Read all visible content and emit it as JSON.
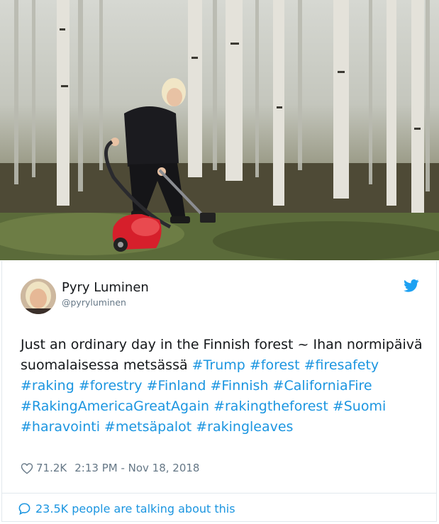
{
  "photo": {
    "subject": "tweet-photo"
  },
  "author": {
    "name": "Pyry Luminen",
    "handle": "@pyryluminen"
  },
  "icons": {
    "platform": "bird-icon",
    "like": "heart-icon",
    "reply": "speech-bubble-icon"
  },
  "tweet": {
    "text_segments": [
      {
        "text": "Just an ordinary day in the Finnish forest ~ Ihan normipäivä suomalaisessa metsässä ",
        "tag": false
      },
      {
        "text": "#Trump",
        "tag": true
      },
      {
        "text": " ",
        "tag": false
      },
      {
        "text": "#forest",
        "tag": true
      },
      {
        "text": " ",
        "tag": false
      },
      {
        "text": "#firesafety",
        "tag": true
      },
      {
        "text": " ",
        "tag": false
      },
      {
        "text": "#raking",
        "tag": true
      },
      {
        "text": " ",
        "tag": false
      },
      {
        "text": "#forestry",
        "tag": true
      },
      {
        "text": " ",
        "tag": false
      },
      {
        "text": "#Finland",
        "tag": true
      },
      {
        "text": " ",
        "tag": false
      },
      {
        "text": "#Finnish",
        "tag": true
      },
      {
        "text": " ",
        "tag": false
      },
      {
        "text": "#CaliforniaFire",
        "tag": true
      },
      {
        "text": " ",
        "tag": false
      },
      {
        "text": "#RakingAmericaGreatAgain",
        "tag": true
      },
      {
        "text": " ",
        "tag": false
      },
      {
        "text": "#rakingtheforest",
        "tag": true
      },
      {
        "text": " ",
        "tag": false
      },
      {
        "text": "#Suomi",
        "tag": true
      },
      {
        "text": " ",
        "tag": false
      },
      {
        "text": "#haravointi",
        "tag": true
      },
      {
        "text": " ",
        "tag": false
      },
      {
        "text": "#metsäpalot",
        "tag": true
      },
      {
        "text": " ",
        "tag": false
      },
      {
        "text": "#rakingleaves",
        "tag": true
      }
    ],
    "likes": "71.2K",
    "timestamp": "2:13 PM - Nov 18, 2018"
  },
  "footer": {
    "talking_text": "23.5K people are talking about this"
  },
  "colors": {
    "link": "#1b95e0",
    "text": "#14171a",
    "muted": "#657786",
    "border": "#e1e8ed"
  }
}
